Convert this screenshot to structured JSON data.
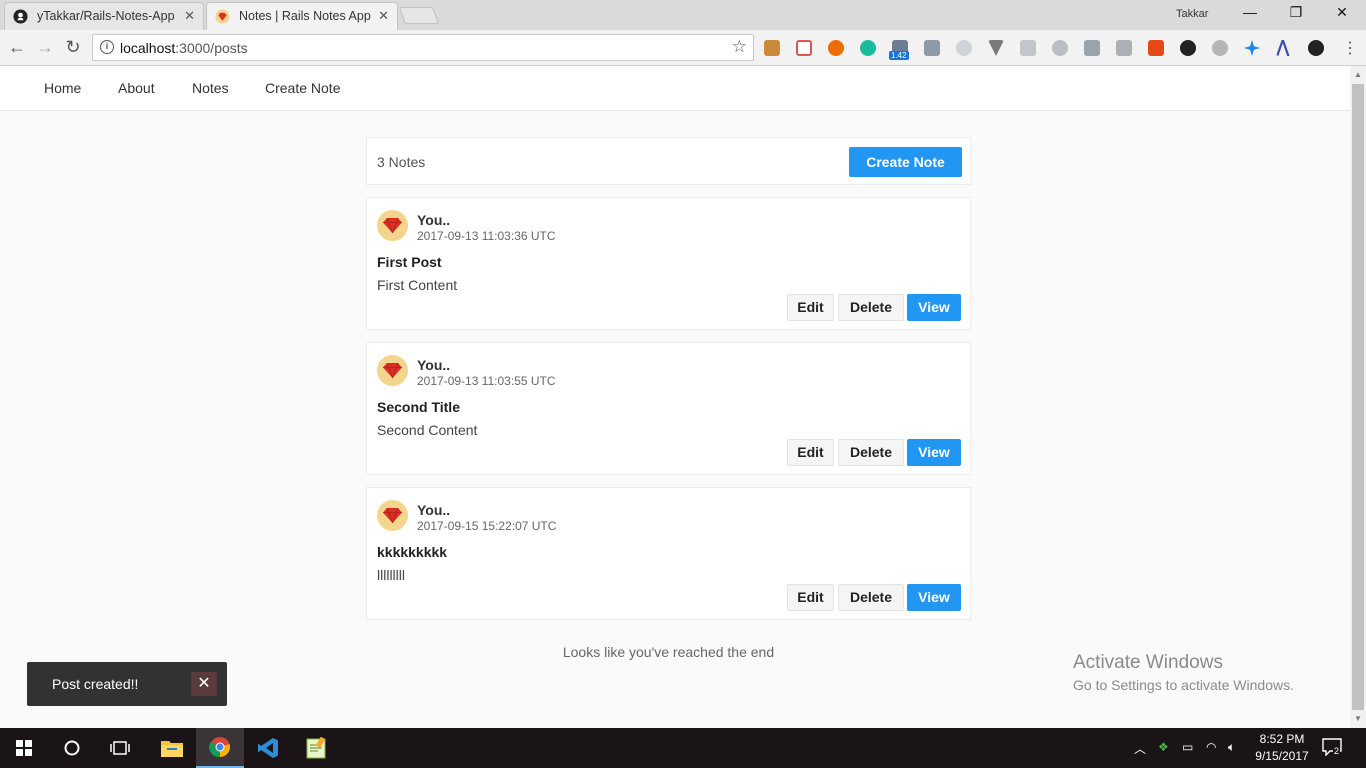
{
  "browser": {
    "tabs": [
      {
        "title": "yTakkar/Rails-Notes-App",
        "icon": "github-icon"
      },
      {
        "title": "Notes | Rails Notes App",
        "icon": "ruby-gem-icon"
      }
    ],
    "profile_name": "Takkar",
    "url_host": "localhost",
    "url_path": ":3000/posts",
    "badge_count": "1.42"
  },
  "nav": {
    "links": [
      "Home",
      "About",
      "Notes",
      "Create Note"
    ]
  },
  "summary": {
    "count_label": "3 Notes",
    "create_label": "Create Note"
  },
  "notes": [
    {
      "author": "You..",
      "date": "2017-09-13 11:03:36 UTC",
      "title": "First Post",
      "content": "First Content",
      "edit": "Edit",
      "delete": "Delete",
      "view": "View"
    },
    {
      "author": "You..",
      "date": "2017-09-13 11:03:55 UTC",
      "title": "Second Title",
      "content": "Second Content",
      "edit": "Edit",
      "delete": "Delete",
      "view": "View"
    },
    {
      "author": "You..",
      "date": "2017-09-15 15:22:07 UTC",
      "title": "kkkkkkkkk",
      "content": "lllllllll",
      "edit": "Edit",
      "delete": "Delete",
      "view": "View"
    }
  ],
  "end_message": "Looks like you've reached the end",
  "snackbar": {
    "message": "Post created!!",
    "close": "✕"
  },
  "watermark": {
    "line1": "Activate Windows",
    "line2": "Go to Settings to activate Windows."
  },
  "taskbar": {
    "time": "8:52 PM",
    "date": "9/15/2017",
    "notification_count": "2"
  },
  "colors": {
    "accent": "#2196f3",
    "snackbar": "#323232"
  }
}
